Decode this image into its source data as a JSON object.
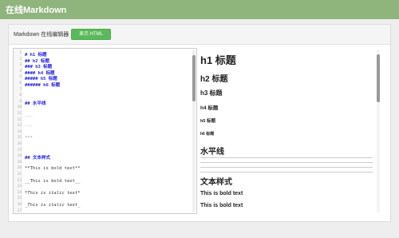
{
  "app": {
    "title": "在线Markdown"
  },
  "panel": {
    "heading": "Markdown 在线编辑器",
    "toggle_button": "显示 HTML"
  },
  "editor": {
    "lines": [
      {
        "n": "1",
        "text": "# h1 标题",
        "kind": "hd"
      },
      {
        "n": "2",
        "text": "## h2 标题",
        "kind": "hd"
      },
      {
        "n": "3",
        "text": "### h3 标题",
        "kind": "hd"
      },
      {
        "n": "4",
        "text": "#### h4 标题",
        "kind": "hd"
      },
      {
        "n": "5",
        "text": "##### h5 标题",
        "kind": "hd"
      },
      {
        "n": "6",
        "text": "###### h6 标题",
        "kind": "hd"
      },
      {
        "n": "7",
        "text": "",
        "kind": ""
      },
      {
        "n": "8",
        "text": "",
        "kind": ""
      },
      {
        "n": "9",
        "text": "## 水平线",
        "kind": "hd"
      },
      {
        "n": "10",
        "text": "",
        "kind": ""
      },
      {
        "n": "11",
        "text": "___",
        "kind": "rule"
      },
      {
        "n": "12",
        "text": "",
        "kind": ""
      },
      {
        "n": "13",
        "text": "---",
        "kind": "rule"
      },
      {
        "n": "14",
        "text": "",
        "kind": ""
      },
      {
        "n": "15",
        "text": "***",
        "kind": "rule"
      },
      {
        "n": "16",
        "text": "",
        "kind": ""
      },
      {
        "n": "17",
        "text": "",
        "kind": ""
      },
      {
        "n": "18",
        "text": "## 文本样式",
        "kind": "hd"
      },
      {
        "n": "19",
        "text": "",
        "kind": ""
      },
      {
        "n": "20",
        "text": "**This is bold text**",
        "kind": ""
      },
      {
        "n": "21",
        "text": "",
        "kind": ""
      },
      {
        "n": "22",
        "text": "__This is bold text__",
        "kind": ""
      },
      {
        "n": "23",
        "text": "",
        "kind": ""
      },
      {
        "n": "24",
        "text": "*This is italic text*",
        "kind": "it"
      },
      {
        "n": "25",
        "text": "",
        "kind": ""
      },
      {
        "n": "26",
        "text": "_This is italic text_",
        "kind": "it"
      },
      {
        "n": "27",
        "text": "",
        "kind": ""
      }
    ]
  },
  "preview": {
    "h1": "h1 标题",
    "h2": "h2 标题",
    "h3": "h3 标题",
    "h4": "h4 标题",
    "h5": "h5 标题",
    "h6": "h6 标题",
    "section_rule": "水平线",
    "section_text": "文本样式",
    "bold_1": "This is bold text",
    "bold_2": "This is bold text"
  },
  "colors": {
    "topbar": "#8fb47c",
    "button": "#5cb85c",
    "heading_syntax": "#1a1ae6"
  }
}
